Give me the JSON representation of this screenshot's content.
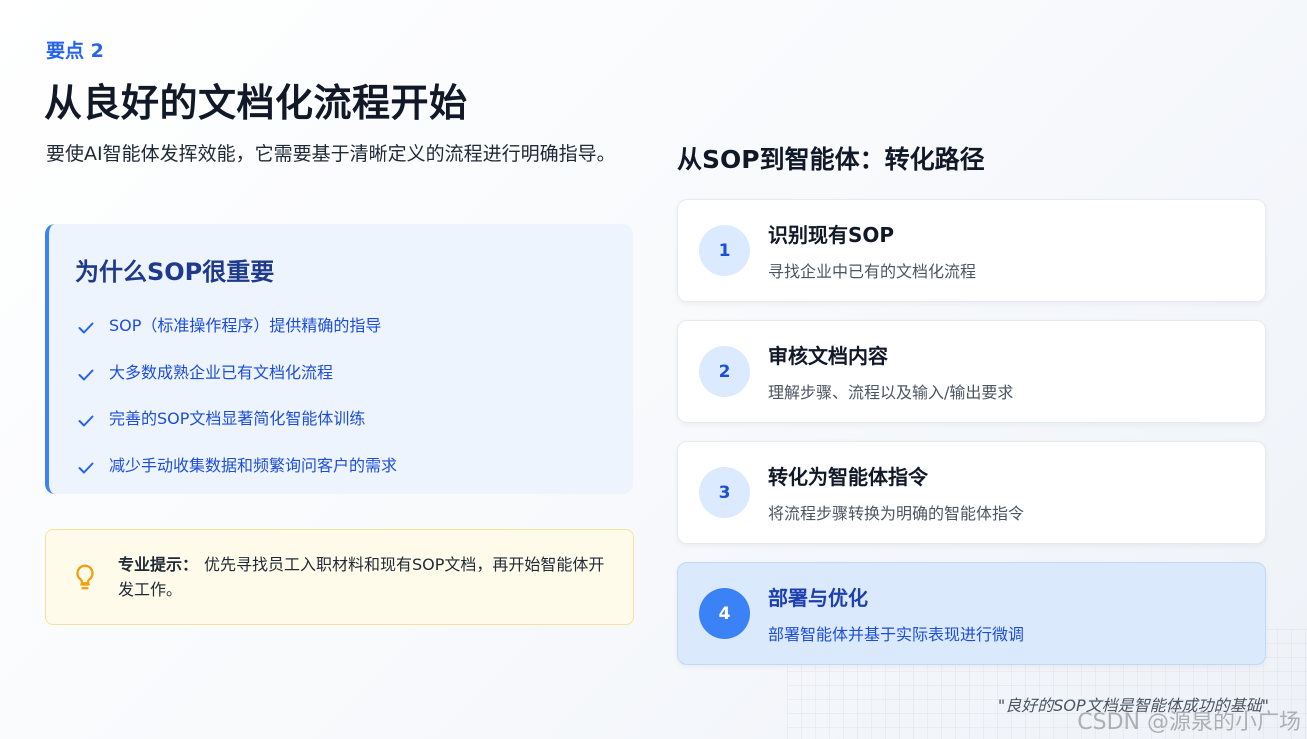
{
  "eyebrow": "要点 2",
  "title": "从良好的文档化流程开始",
  "intro": "要使AI智能体发挥效能，它需要基于清晰定义的流程进行明确指导。",
  "why": {
    "title": "为什么SOP很重要",
    "items": [
      "SOP（标准操作程序）提供精确的指导",
      "大多数成熟企业已有文档化流程",
      "完善的SOP文档显著简化智能体训练",
      "减少手动收集数据和频繁询问客户的需求"
    ]
  },
  "tip": {
    "label": "专业提示：",
    "text": "优先寻找员工入职材料和现有SOP文档，再开始智能体开发工作。"
  },
  "path": {
    "title": "从SOP到智能体：转化路径",
    "steps": [
      {
        "num": "1",
        "title": "识别现有SOP",
        "desc": "寻找企业中已有的文档化流程"
      },
      {
        "num": "2",
        "title": "审核文档内容",
        "desc": "理解步骤、流程以及输入/输出要求"
      },
      {
        "num": "3",
        "title": "转化为智能体指令",
        "desc": "将流程步骤转换为明确的智能体指令"
      },
      {
        "num": "4",
        "title": "部署与优化",
        "desc": "部署智能体并基于实际表现进行微调"
      }
    ]
  },
  "quote": "\"良好的SOP文档是智能体成功的基础\"",
  "watermark": "CSDN @源泉的小广场",
  "colors": {
    "accent": "#2563eb",
    "accent_dark": "#1e3a8a",
    "active_step_bg": "#dbe9fc",
    "tip_bg": "#fefbea",
    "tip_icon": "#f59e0b"
  }
}
